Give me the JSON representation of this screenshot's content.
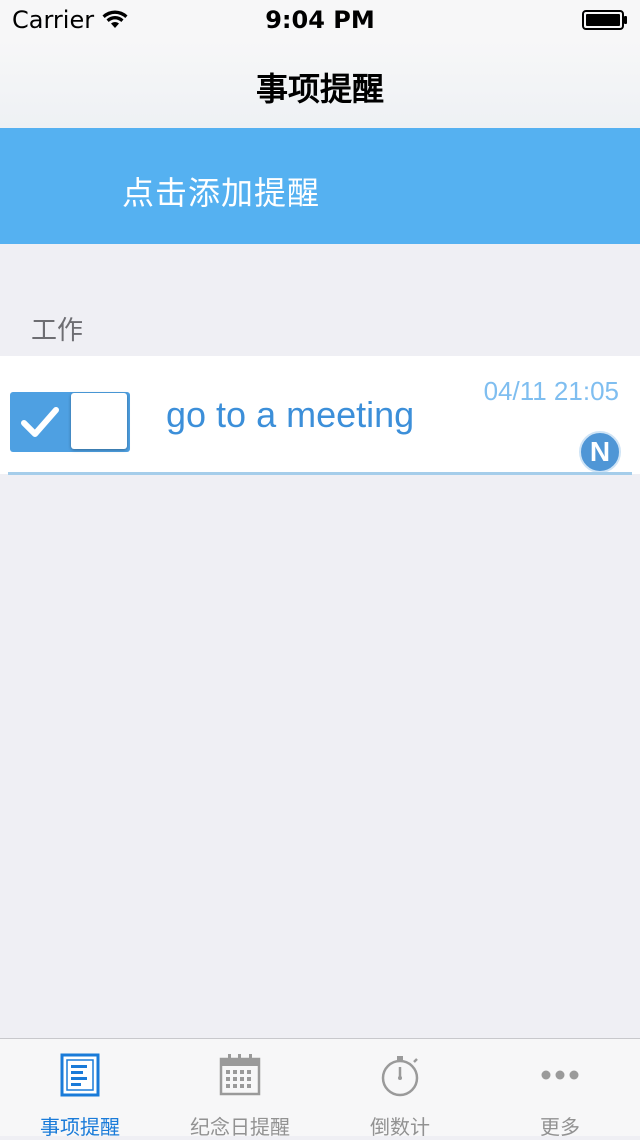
{
  "status_bar": {
    "carrier": "Carrier",
    "time": "9:04 PM"
  },
  "nav": {
    "title": "事项提醒"
  },
  "add_banner": {
    "label": "点击添加提醒"
  },
  "section": {
    "header": "工作"
  },
  "reminders": [
    {
      "title": "go to a meeting",
      "datetime": "04/11 21:05",
      "enabled": true,
      "badge": "N"
    }
  ],
  "tabs": [
    {
      "label": "事项提醒",
      "icon": "list-doc-icon",
      "active": true
    },
    {
      "label": "纪念日提醒",
      "icon": "calendar-icon",
      "active": false
    },
    {
      "label": "倒数计",
      "icon": "stopwatch-icon",
      "active": false
    },
    {
      "label": "更多",
      "icon": "more-dots-icon",
      "active": false
    }
  ],
  "colors": {
    "accent": "#55b1f1",
    "active_tab": "#1a7bd9",
    "inactive_tab": "#929292",
    "background": "#efeff4"
  }
}
